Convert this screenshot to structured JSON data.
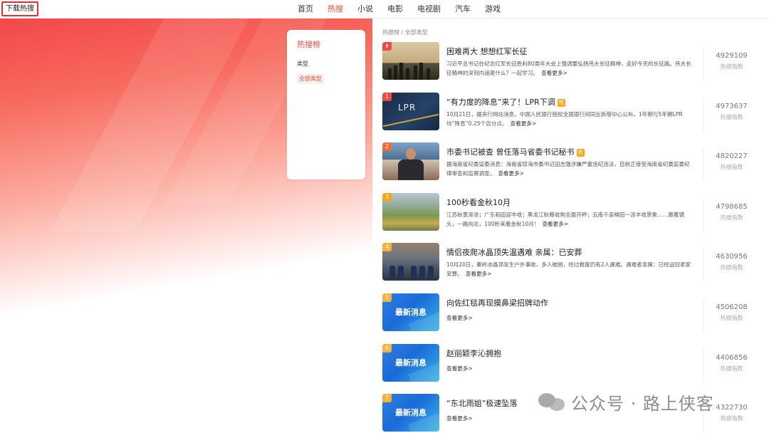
{
  "header": {
    "download_label": "下载热搜",
    "nav": [
      {
        "label": "首页",
        "active": false
      },
      {
        "label": "热搜",
        "active": true
      },
      {
        "label": "小说",
        "active": false
      },
      {
        "label": "电影",
        "active": false
      },
      {
        "label": "电视剧",
        "active": false
      },
      {
        "label": "汽车",
        "active": false
      },
      {
        "label": "游戏",
        "active": false
      }
    ]
  },
  "sidebar": {
    "title": "热搜榜",
    "type_label": "类型",
    "selected_type": "全部类型"
  },
  "main": {
    "breadcrumb": "热搜榜 / 全部类型",
    "stat_label": "热搜指数",
    "more_label": "查看更多>",
    "hot_tag": "热",
    "items": [
      {
        "rank": "⬆",
        "title": "困难再大 想想红军长征",
        "hot": false,
        "desc": "习近平总书记在纪念红军长征胜利80周年大会上强调要弘扬伟大长征精神，走好今天的长征路。伟大长征精神的深刻内涵是什么？一起学习。",
        "index": "4929109",
        "thumb": "photo1"
      },
      {
        "rank": "1",
        "title": "“有力度的降息”来了！LPR下调",
        "hot": true,
        "desc": "10月21日，据央行网站消息，中国人民银行授权全国银行间同业拆借中心公布，1年期与5年期LPR均“降息”0.25个百分点。",
        "index": "4973637",
        "thumb": "lpr",
        "thumb_text": "LPR"
      },
      {
        "rank": "2",
        "title": "市委书记被查 曾任落马省委书记秘书",
        "hot": true,
        "desc": "据海南省纪委监委消息：海南省琼海市委书记田志强涉嫌严重违纪违法，目前正接受海南省纪委监委纪律审查和监察调查。",
        "index": "4820227",
        "thumb": "person"
      },
      {
        "rank": "3",
        "title": "100秒看金秋10月",
        "hot": false,
        "desc": "江苏秋意渐浓；广东稻田迎丰收；黑龙江秋粮收购全面开秤；云南千亩梯田一派丰收景象……跟着镜头，一路向北，100秒来看金秋10月！",
        "index": "4798685",
        "thumb": "landscape"
      },
      {
        "rank": "4",
        "title": "情侣夜爬冰晶顶失温遇难 亲属：已安葬",
        "hot": false,
        "desc": "10月20日，秦岭冰晶顶发生户外事故，多人被困，经过救援仍有2人遇难。遇难者亲属：已经运回老家安葬。",
        "index": "4630956",
        "thumb": "scene"
      },
      {
        "rank": "5",
        "title": "向佐红毯再现摸鼻梁招牌动作",
        "hot": false,
        "desc": "",
        "index": "4506208",
        "thumb": "news",
        "thumb_text": "最新消息"
      },
      {
        "rank": "6",
        "title": "赵丽颖李沁拥抱",
        "hot": false,
        "desc": "",
        "index": "4406856",
        "thumb": "news",
        "thumb_text": "最新消息"
      },
      {
        "rank": "7",
        "title": "“东北雨姐”极速坠落",
        "hot": false,
        "desc": "",
        "index": "4322730",
        "thumb": "news",
        "thumb_text": "最新消息"
      }
    ]
  },
  "watermark": {
    "text": "公众号 · 路上侠客",
    "icon": "wechat-icon"
  }
}
